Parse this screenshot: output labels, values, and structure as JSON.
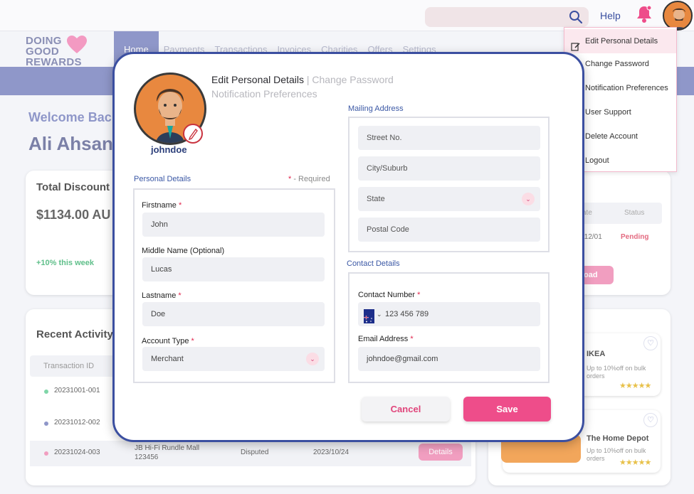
{
  "topbar": {
    "help_label": "Help",
    "search_placeholder": ""
  },
  "logo": {
    "line1": "DOING",
    "line2": "GOOD",
    "line3": "REWARDS"
  },
  "nav": {
    "items": [
      "Home",
      "Payments",
      "Transactions",
      "Invoices",
      "Charities",
      "Offers",
      "Settings"
    ]
  },
  "dashboard": {
    "welcome": "Welcome Back",
    "user_name": "Ali Ahsan",
    "discount_title": "Total Discount",
    "discount_value": "$1134.00 AU",
    "discount_week": "+10% this week",
    "activity_title": "Recent Activity",
    "activity_header_id": "Transaction ID",
    "rows": [
      {
        "id": "20231001-001",
        "desc": "",
        "status": "",
        "date": "",
        "dot": "#7fd6a8"
      },
      {
        "id": "20231012-002",
        "desc": "",
        "status": "",
        "date": "",
        "dot": "#8f97c9"
      },
      {
        "id": "20231024-003",
        "desc": "JB Hi-Fi Rundle Mall 123456",
        "status": "Disputed",
        "date": "2023/10/24",
        "dot": "#f19ec0",
        "action": "Details"
      }
    ],
    "right_card": {
      "col_date": "ate",
      "col_status": "Status",
      "date": "/12/01",
      "status": "Pending",
      "button": "oad"
    },
    "offers": [
      {
        "name": "IKEA",
        "desc": "Up to 10%off on bulk orders",
        "stars": "★★★★★"
      },
      {
        "name": "The Home Depot",
        "desc": "Up to 10%off on bulk orders",
        "stars": "★★★★★"
      }
    ]
  },
  "menu": {
    "items": [
      {
        "label": "Edit  Personal Details",
        "icon": "edit-icon"
      },
      {
        "label": "Change Password"
      },
      {
        "label": "Notification Preferences"
      },
      {
        "label": "User Support"
      },
      {
        "label": "Delete Account"
      },
      {
        "label": "Logout"
      }
    ]
  },
  "modal": {
    "tab_edit": "Edit Personal Details",
    "tab_sep": " | ",
    "tab_password": "Change Password",
    "tab_notifications": "Notification Preferences",
    "username": "johndoe",
    "personal_label": "Personal Details",
    "required_note": " - Required",
    "firstname_label": "Firstname",
    "firstname_value": "John",
    "middlename_label": "Middle Name (Optional)",
    "middlename_value": "Lucas",
    "lastname_label": "Lastname",
    "lastname_value": "Doe",
    "account_type_label": "Account Type",
    "account_type_value": "Merchant",
    "mailing_label": "Mailing Address",
    "street_placeholder": "Street No.",
    "city_placeholder": "City/Suburb",
    "state_placeholder": "State",
    "postal_placeholder": "Postal Code",
    "contact_label": "Contact Details",
    "contact_number_label": "Contact Number",
    "contact_number_value": "123 456 789",
    "email_label": "Email Address",
    "email_value": "johndoe@gmail.com",
    "cancel": "Cancel",
    "save": "Save"
  },
  "colors": {
    "brand": "#8f97c9",
    "accent": "#ee4d8a",
    "modal_border": "#3b4fa0"
  }
}
